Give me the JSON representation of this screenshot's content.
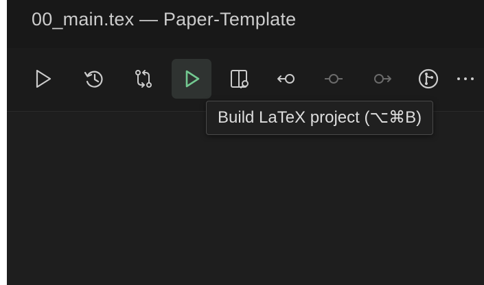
{
  "window": {
    "title": "00_main.tex — Paper-Template"
  },
  "toolbar": {
    "buttons": [
      {
        "name": "run",
        "icon": "play-outline-icon"
      },
      {
        "name": "history",
        "icon": "history-icon"
      },
      {
        "name": "compare-changes",
        "icon": "git-compare-icon"
      },
      {
        "name": "build-latex-project",
        "icon": "play-outline-icon",
        "active": true
      },
      {
        "name": "view-pdf",
        "icon": "split-preview-search-icon"
      },
      {
        "name": "previous-commit",
        "icon": "arrow-left-commit-icon"
      },
      {
        "name": "current-commit",
        "icon": "commit-icon"
      },
      {
        "name": "next-commit",
        "icon": "arrow-right-commit-icon"
      },
      {
        "name": "git-graph",
        "icon": "git-graph-circle-icon"
      },
      {
        "name": "more-actions",
        "icon": "ellipsis-icon"
      }
    ]
  },
  "tooltip": {
    "text": "Build LaTeX project (⌥⌘B)"
  },
  "colors": {
    "accent_green": "#73c991",
    "icon_default": "#cccccc",
    "icon_disabled": "#6b6b6b",
    "titlebar_bg": "#181818",
    "editor_bg": "#1e1e1e"
  }
}
